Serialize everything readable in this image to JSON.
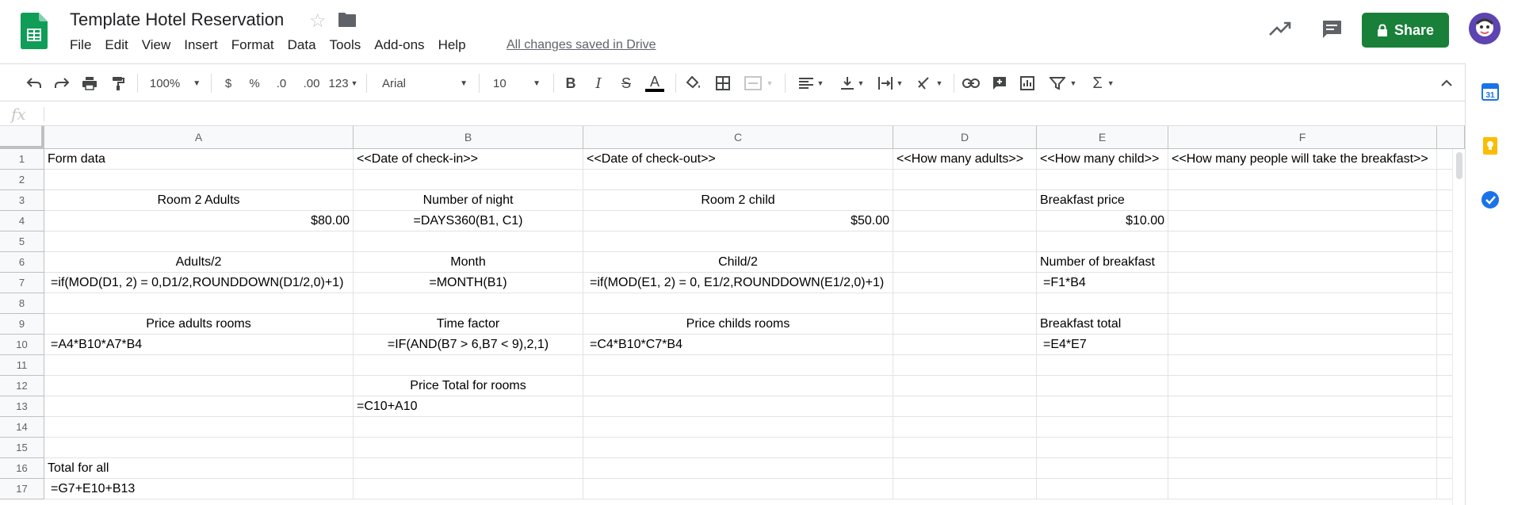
{
  "app": {
    "title": "Template Hotel Reservation",
    "saved_status": "All changes saved in Drive",
    "share_label": "Share"
  },
  "menu": [
    "File",
    "Edit",
    "View",
    "Insert",
    "Format",
    "Data",
    "Tools",
    "Add-ons",
    "Help"
  ],
  "toolbar": {
    "zoom": "100%",
    "currency": "$",
    "percent": "%",
    "decrease_decimal": ".0",
    "increase_decimal": ".00",
    "more_formats": "123",
    "font": "Arial",
    "font_size": "10",
    "bold": "B",
    "italic": "I",
    "strike": "S",
    "text_color": "A"
  },
  "formula_bar": {
    "label": "fx",
    "value": ""
  },
  "columns": [
    "A",
    "B",
    "C",
    "D",
    "E",
    "F"
  ],
  "rows": [
    "1",
    "2",
    "3",
    "4",
    "5",
    "6",
    "7",
    "8",
    "9",
    "10",
    "11",
    "12",
    "13",
    "14",
    "15",
    "16",
    "17"
  ],
  "cells": {
    "A1": "Form data",
    "B1": "<<Date of check-in>>",
    "C1": "<<Date of check-out>>",
    "D1": "<<How many adults>>",
    "E1": "<<How many child>>",
    "F1": "<<How many people will take the breakfast>>",
    "A3": "Room 2 Adults",
    "B3": "Number of night",
    "C3": "Room 2 child",
    "E3": "Breakfast price",
    "A4": "$80.00",
    "B4": "=DAYS360(B1, C1)",
    "C4": "$50.00",
    "E4": "$10.00",
    "A6": "Adults/2",
    "B6": "Month",
    "C6": "Child/2",
    "E6": "Number of breakfast",
    "A7": "=if(MOD(D1, 2) = 0,D1/2,ROUNDDOWN(D1/2,0)+1)",
    "B7": "=MONTH(B1)",
    "C7": "=if(MOD(E1, 2) = 0, E1/2,ROUNDDOWN(E1/2,0)+1)",
    "E7": "=F1*B4",
    "A9": "Price adults rooms",
    "B9": "Time factor",
    "C9": "Price childs rooms",
    "E9": "Breakfast total",
    "A10": "=A4*B10*A7*B4",
    "B10": "=IF(AND(B7 > 6,B7 < 9),2,1)",
    "C10": "=C4*B10*C7*B4",
    "E10": "=E4*E7",
    "B12": "Price Total for rooms",
    "B13": "=C10+A10",
    "A16": "Total for all",
    "A17": "=G7+E10+B13"
  },
  "colors": {
    "share_green": "#188038",
    "sheets_green": "#0f9d58",
    "header_bg": "#f8f9fa",
    "gridline": "#e2e3e3"
  },
  "icons": {
    "star": "star-icon",
    "folder": "folder-icon",
    "trend": "activity-icon",
    "comment": "comment-icon",
    "lock": "lock-icon"
  }
}
